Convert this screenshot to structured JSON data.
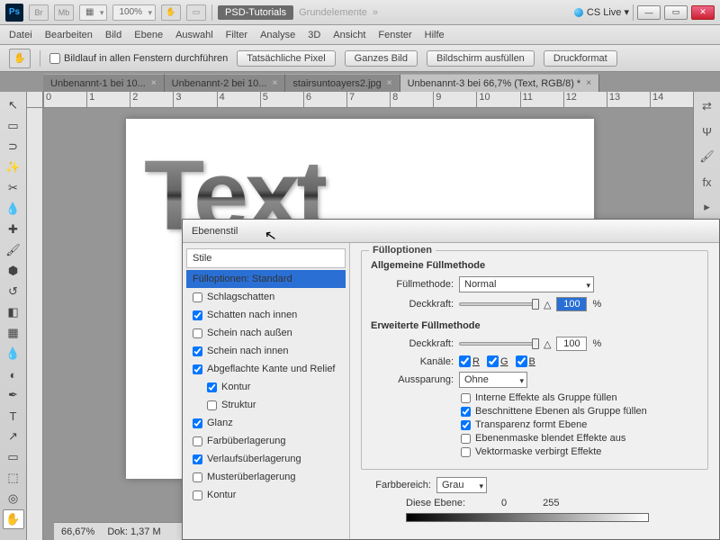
{
  "topbar": {
    "br": "Br",
    "mb": "Mb",
    "zoom": "100%",
    "psd_tut": "PSD-Tutorials",
    "grund": "Grundelemente",
    "arrows": "»",
    "cs": "CS Live ▾"
  },
  "menu": [
    "Datei",
    "Bearbeiten",
    "Bild",
    "Ebene",
    "Auswahl",
    "Filter",
    "Analyse",
    "3D",
    "Ansicht",
    "Fenster",
    "Hilfe"
  ],
  "optbar": {
    "scroll": "Bildlauf in allen Fenstern durchführen",
    "b1": "Tatsächliche Pixel",
    "b2": "Ganzes Bild",
    "b3": "Bildschirm ausfüllen",
    "b4": "Druckformat"
  },
  "tabs": [
    {
      "label": "Unbenannt-1 bei 10...",
      "active": false
    },
    {
      "label": "Unbenannt-2 bei 10...",
      "active": false
    },
    {
      "label": "stairsuntoayers2.jpg",
      "active": false
    },
    {
      "label": "Unbenannt-3 bei 66,7% (Text, RGB/8) *",
      "active": true
    }
  ],
  "canvas_text": "Text",
  "status": {
    "zoom": "66,67%",
    "doc": "Dok: 1,37 M"
  },
  "dialog": {
    "title": "Ebenenstil",
    "styles_header": "Stile",
    "styles": [
      {
        "label": "Fülloptionen: Standard",
        "sel": true,
        "chk": null
      },
      {
        "label": "Schlagschatten",
        "chk": false
      },
      {
        "label": "Schatten nach innen",
        "chk": true
      },
      {
        "label": "Schein nach außen",
        "chk": false
      },
      {
        "label": "Schein nach innen",
        "chk": true
      },
      {
        "label": "Abgeflachte Kante und Relief",
        "chk": true
      },
      {
        "label": "Kontur",
        "chk": true,
        "indent": true
      },
      {
        "label": "Struktur",
        "chk": false,
        "indent": true
      },
      {
        "label": "Glanz",
        "chk": true
      },
      {
        "label": "Farbüberlagerung",
        "chk": false
      },
      {
        "label": "Verlaufsüberlagerung",
        "chk": true
      },
      {
        "label": "Musterüberlagerung",
        "chk": false
      },
      {
        "label": "Kontur",
        "chk": false
      }
    ],
    "fill_group": "Fülloptionen",
    "general": "Allgemeine Füllmethode",
    "blend_lbl": "Füllmethode:",
    "blend_val": "Normal",
    "opac_lbl": "Deckkraft:",
    "opac_val": "100",
    "pct": "%",
    "advanced": "Erweiterte Füllmethode",
    "fill_opac_lbl": "Deckkraft:",
    "fill_opac_val": "100",
    "channels_lbl": "Kanäle:",
    "ch_r": "R",
    "ch_g": "G",
    "ch_b": "B",
    "knockout_lbl": "Aussparung:",
    "knockout_val": "Ohne",
    "opts": [
      {
        "label": "Interne Effekte als Gruppe füllen",
        "chk": false
      },
      {
        "label": "Beschnittene Ebenen als Gruppe füllen",
        "chk": true
      },
      {
        "label": "Transparenz formt Ebene",
        "chk": true
      },
      {
        "label": "Ebenenmaske blendet Effekte aus",
        "chk": false
      },
      {
        "label": "Vektormaske verbirgt Effekte",
        "chk": false
      }
    ],
    "blendif_lbl": "Farbbereich:",
    "blendif_val": "Grau",
    "this_layer": "Diese Ebene:",
    "v0": "0",
    "v255": "255"
  }
}
